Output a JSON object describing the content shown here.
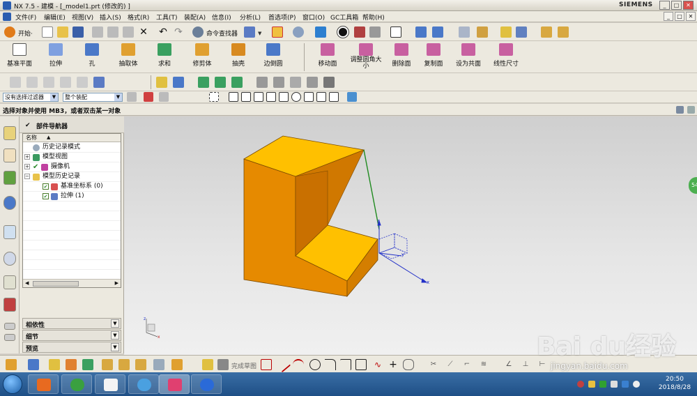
{
  "window": {
    "title": "NX 7.5 - 建模 - [_model1.prt (修改的) ]",
    "brand": "SIEMENS",
    "minimize": "_",
    "maximize": "□",
    "close": "✕"
  },
  "menu": {
    "items": [
      "文件(F)",
      "编辑(E)",
      "视图(V)",
      "插入(S)",
      "格式(R)",
      "工具(T)",
      "装配(A)",
      "信息(I)",
      "分析(L)",
      "首选项(P)",
      "窗口(O)",
      "GC工具箱",
      "帮助(H)"
    ],
    "right": [
      "_",
      "□",
      "✕"
    ]
  },
  "toolbar_standard": {
    "start_label": "开始·",
    "command_finder": "命令查找器"
  },
  "toolbar_features": {
    "items": [
      "基准平面",
      "拉伸",
      "孔",
      "抽取体",
      "求和",
      "修剪体",
      "抽壳",
      "边倒圆",
      "移动面",
      "调整圆角大小",
      "删除面",
      "复制面",
      "设为共面",
      "线性尺寸"
    ]
  },
  "selection_bar": {
    "filter": "没有选择过滤器",
    "scope": "整个装配"
  },
  "status": {
    "message": "选择对象并使用 MB3，或者双击某一对象"
  },
  "navigator": {
    "title": "部件导航器",
    "column": "名称",
    "rows": [
      {
        "text": "历史记录模式",
        "indent": 0
      },
      {
        "text": "模型视图",
        "indent": 0
      },
      {
        "text": "摄像机",
        "indent": 0
      },
      {
        "text": "模型历史记录",
        "indent": 0
      },
      {
        "text": "基准坐标系 (0)",
        "indent": 1
      },
      {
        "text": "拉伸 (1)",
        "indent": 1
      }
    ],
    "panels": [
      "相依性",
      "细节",
      "预览"
    ]
  },
  "viewport": {
    "axis_labels": {
      "x": "x",
      "y": "y",
      "z": "z"
    },
    "badge": "54"
  },
  "bottom_toolbar": {
    "sketch_label": "完成草图"
  },
  "taskbar": {
    "time": "20:50",
    "date": "2018/8/28"
  },
  "watermark": {
    "brand": "Bai du经验",
    "url": "jingyan.baidu.com"
  },
  "colors": {
    "model_top": "#ffc000",
    "model_front": "#e68a00",
    "model_side": "#c77200",
    "accent_blue": "#2a5db0"
  }
}
